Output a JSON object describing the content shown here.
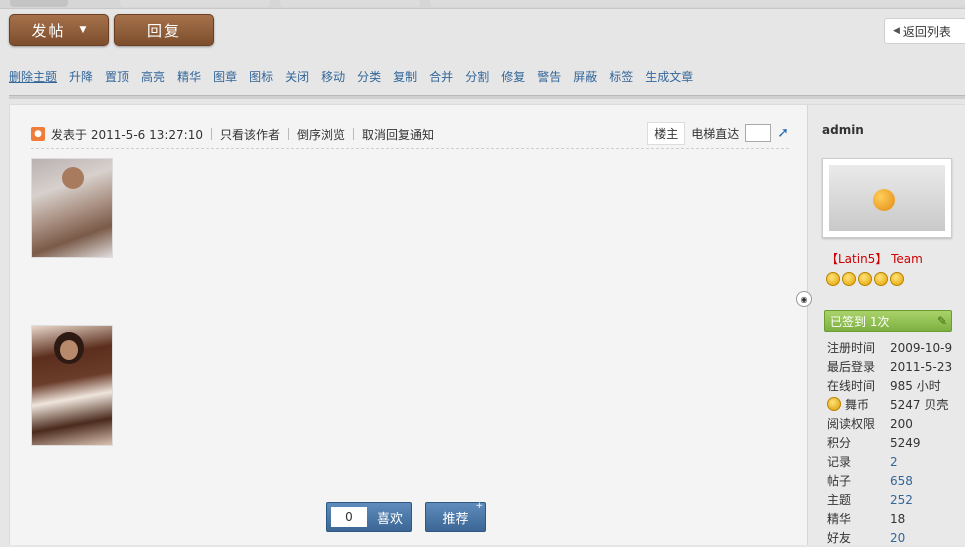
{
  "toolbar": {
    "post_label": "发帖",
    "reply_label": "回复",
    "back_label": "返回列表"
  },
  "mod_actions": [
    "删除主题",
    "升降",
    "置顶",
    "高亮",
    "精华",
    "图章",
    "图标",
    "关闭",
    "移动",
    "分类",
    "复制",
    "合并",
    "分割",
    "修复",
    "警告",
    "屏蔽",
    "标签",
    "生成文章"
  ],
  "post": {
    "posted_at": "发表于 2011-5-6 13:27:10",
    "only_author": "只看该作者",
    "reverse_browse": "倒序浏览",
    "cancel_notify": "取消回复通知",
    "floor_label": "楼主",
    "elevator_label": "电梯直达",
    "like_count": "0",
    "like_label": "喜欢",
    "recommend_label": "推荐"
  },
  "user": {
    "name": "admin",
    "team": "【Latin5】 Team",
    "signed": "已签到 1次",
    "stats": [
      {
        "k": "注册时间",
        "v": "2009-10-9",
        "link": false,
        "coin": false
      },
      {
        "k": "最后登录",
        "v": "2011-5-23",
        "link": false,
        "coin": false
      },
      {
        "k": "在线时间",
        "v": "985 小时",
        "link": false,
        "coin": false
      },
      {
        "k": "舞币",
        "v": "5247 贝壳",
        "link": false,
        "coin": true
      },
      {
        "k": "阅读权限",
        "v": "200",
        "link": false,
        "coin": false
      },
      {
        "k": "积分",
        "v": "5249",
        "link": false,
        "coin": false
      },
      {
        "k": "记录",
        "v": "2",
        "link": true,
        "coin": false
      },
      {
        "k": "帖子",
        "v": "658",
        "link": true,
        "coin": false
      },
      {
        "k": "主题",
        "v": "252",
        "link": true,
        "coin": false
      },
      {
        "k": "精华",
        "v": "18",
        "link": false,
        "coin": false
      },
      {
        "k": "好友",
        "v": "20",
        "link": true,
        "coin": false
      }
    ]
  }
}
